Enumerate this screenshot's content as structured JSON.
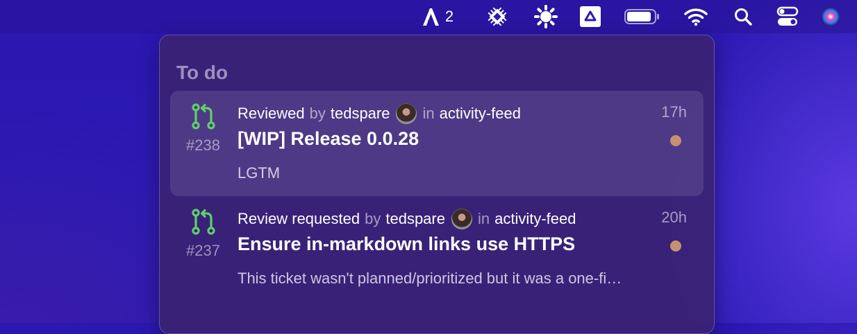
{
  "menubar": {
    "app_count": "2",
    "icons": [
      "app-logo-icon",
      "cpu-chip-icon",
      "sun-icon",
      "drive-icon",
      "battery-icon",
      "wifi-icon",
      "search-icon",
      "control-center-icon",
      "siri-icon"
    ]
  },
  "panel": {
    "section_title": "To do",
    "items": [
      {
        "reason": "Reviewed",
        "by": "by",
        "user": "tedspare",
        "in": "in",
        "repo": "activity-feed",
        "time": "17h",
        "number": "#238",
        "title": "[WIP] Release 0.0.28",
        "body": "LGTM"
      },
      {
        "reason": "Review requested",
        "by": "by",
        "user": "tedspare",
        "in": "in",
        "repo": "activity-feed",
        "time": "20h",
        "number": "#237",
        "title": "Ensure in-markdown links use HTTPS",
        "body": "This ticket wasn't planned/prioritized but it was a one-fi…"
      }
    ]
  },
  "colors": {
    "pr_icon": "#5fcf6a",
    "unread_dot": "#c79070",
    "panel_bg": "#3a2276",
    "desktop": "#2b1ab5"
  }
}
